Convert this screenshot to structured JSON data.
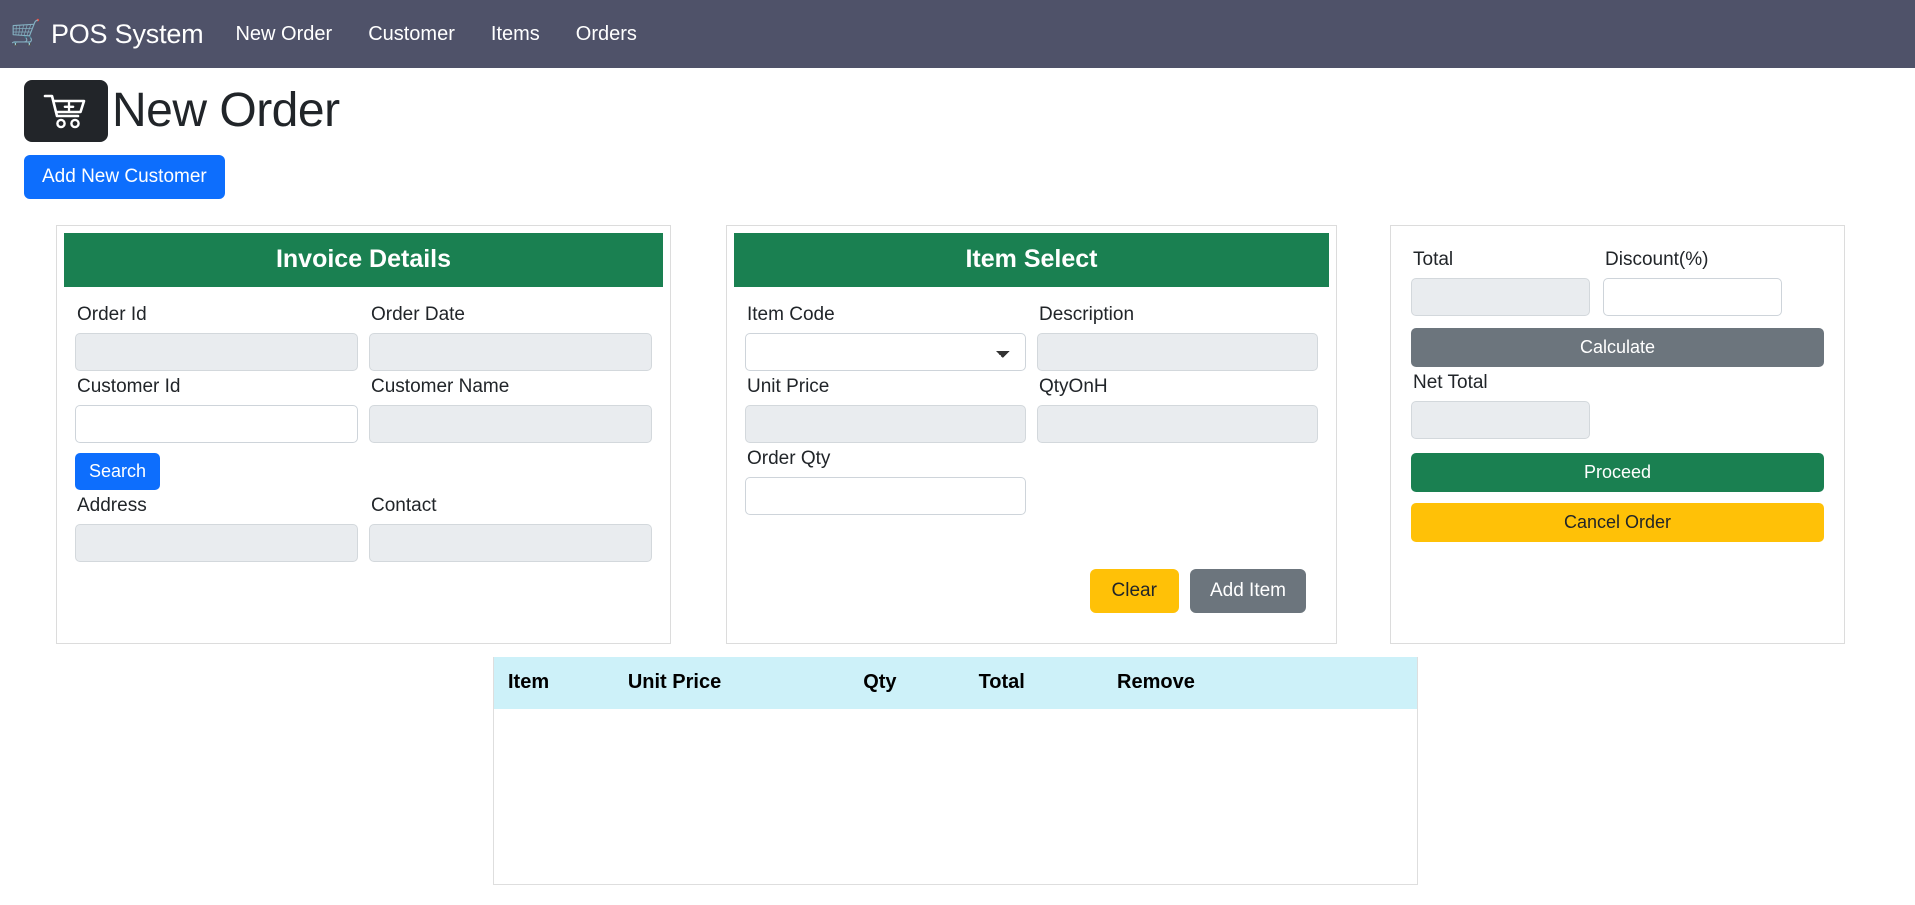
{
  "navbar": {
    "brand": "POS System",
    "brand_icon": "shopping-cart-icon",
    "links": [
      {
        "label": "New Order"
      },
      {
        "label": "Customer"
      },
      {
        "label": "Items"
      },
      {
        "label": "Orders"
      }
    ],
    "background_color": "#4f5269"
  },
  "header": {
    "title": "New Order",
    "cart_icon": "cart-plus-icon",
    "add_customer_label": "Add New Customer",
    "add_customer_color": "#0d6efd"
  },
  "invoice_panel": {
    "title": "Invoice Details",
    "header_color": "#1a8051",
    "fields": {
      "order_id": {
        "label": "Order Id",
        "value": "",
        "placeholder": "",
        "disabled": true
      },
      "order_date": {
        "label": "Order Date",
        "value": "",
        "placeholder": "",
        "disabled": true
      },
      "customer_id": {
        "label": "Customer Id",
        "value": "",
        "placeholder": "",
        "disabled": false
      },
      "customer_name": {
        "label": "Customer Name",
        "value": "",
        "placeholder": "",
        "disabled": true
      },
      "address": {
        "label": "Address",
        "value": "",
        "placeholder": "",
        "disabled": true
      },
      "contact": {
        "label": "Contact",
        "value": "",
        "placeholder": "",
        "disabled": true
      }
    },
    "search_label": "Search"
  },
  "item_panel": {
    "title": "Item Select",
    "header_color": "#1a8051",
    "fields": {
      "item_code": {
        "label": "Item Code",
        "value": "",
        "selected_option": "",
        "options": [
          ""
        ]
      },
      "description": {
        "label": "Description",
        "value": "",
        "placeholder": "",
        "disabled": true
      },
      "unit_price": {
        "label": "Unit Price",
        "value": "",
        "placeholder": "",
        "disabled": true
      },
      "qty_on_hand": {
        "label": "QtyOnH",
        "value": "",
        "placeholder": "",
        "disabled": true
      },
      "order_qty": {
        "label": "Order Qty",
        "value": "",
        "placeholder": "",
        "disabled": false
      }
    },
    "clear_label": "Clear",
    "clear_color": "#ffc107",
    "add_item_label": "Add Item",
    "add_item_color": "#6c757d"
  },
  "summary_panel": {
    "fields": {
      "total": {
        "label": "Total",
        "value": "",
        "placeholder": "",
        "disabled": true
      },
      "discount": {
        "label": "Discount(%)",
        "value": "",
        "placeholder": "",
        "disabled": false
      },
      "net_total": {
        "label": "Net Total",
        "value": "",
        "placeholder": "",
        "disabled": true
      }
    },
    "calculate_label": "Calculate",
    "calculate_color": "#6c757d",
    "proceed_label": "Proceed",
    "proceed_color": "#1a8051",
    "cancel_label": "Cancel Order",
    "cancel_color": "#ffc107"
  },
  "cart_table": {
    "header_color": "#cdf1f9",
    "columns": [
      {
        "label": "Item"
      },
      {
        "label": "Unit Price"
      },
      {
        "label": "Qty"
      },
      {
        "label": "Total"
      },
      {
        "label": "Remove"
      }
    ],
    "rows": []
  }
}
